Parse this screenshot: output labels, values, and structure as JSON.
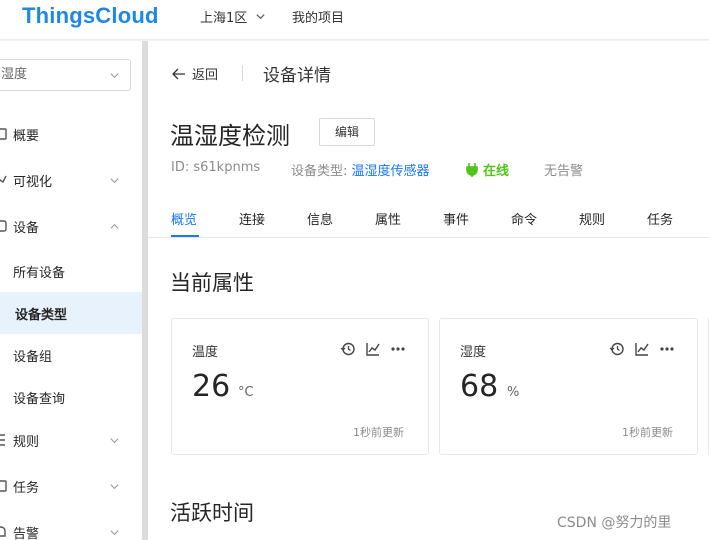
{
  "header": {
    "logo": "ThingsCloud",
    "region": "上海1区",
    "projects": "我的项目"
  },
  "sidebar": {
    "select_value": "湿度",
    "items": [
      {
        "label": "概要",
        "icon": "dashboard-icon"
      },
      {
        "label": "可视化",
        "icon": "chart-icon"
      },
      {
        "label": "设备",
        "icon": "device-icon"
      },
      {
        "label": "所有设备"
      },
      {
        "label": "设备类型"
      },
      {
        "label": "设备组"
      },
      {
        "label": "设备查询"
      },
      {
        "label": "规则",
        "icon": "rule-icon"
      },
      {
        "label": "任务",
        "icon": "task-icon"
      },
      {
        "label": "告警",
        "icon": "alarm-icon"
      }
    ]
  },
  "page": {
    "back_label": "返回",
    "breadcrumb_title": "设备详情",
    "device_name": "温湿度检测",
    "edit_label": "编辑",
    "device_id": "ID: s61kpnms",
    "type_label": "设备类型: ",
    "type_value": "温湿度传感器",
    "status": "在线",
    "alarm_status": "无告警"
  },
  "tabs": [
    "概览",
    "连接",
    "信息",
    "属性",
    "事件",
    "命令",
    "规则",
    "任务"
  ],
  "current_properties": {
    "title": "当前属性",
    "cards": [
      {
        "label": "温度",
        "value": "26",
        "unit": "°C",
        "updated": "1秒前更新"
      },
      {
        "label": "湿度",
        "value": "68",
        "unit": "%",
        "updated": "1秒前更新"
      }
    ]
  },
  "active_time": {
    "title": "活跃时间"
  },
  "watermark": "CSDN @努力的里",
  "colors": {
    "brand": "#1e88e5",
    "accent": "#1677ff",
    "online": "#52c41a"
  }
}
